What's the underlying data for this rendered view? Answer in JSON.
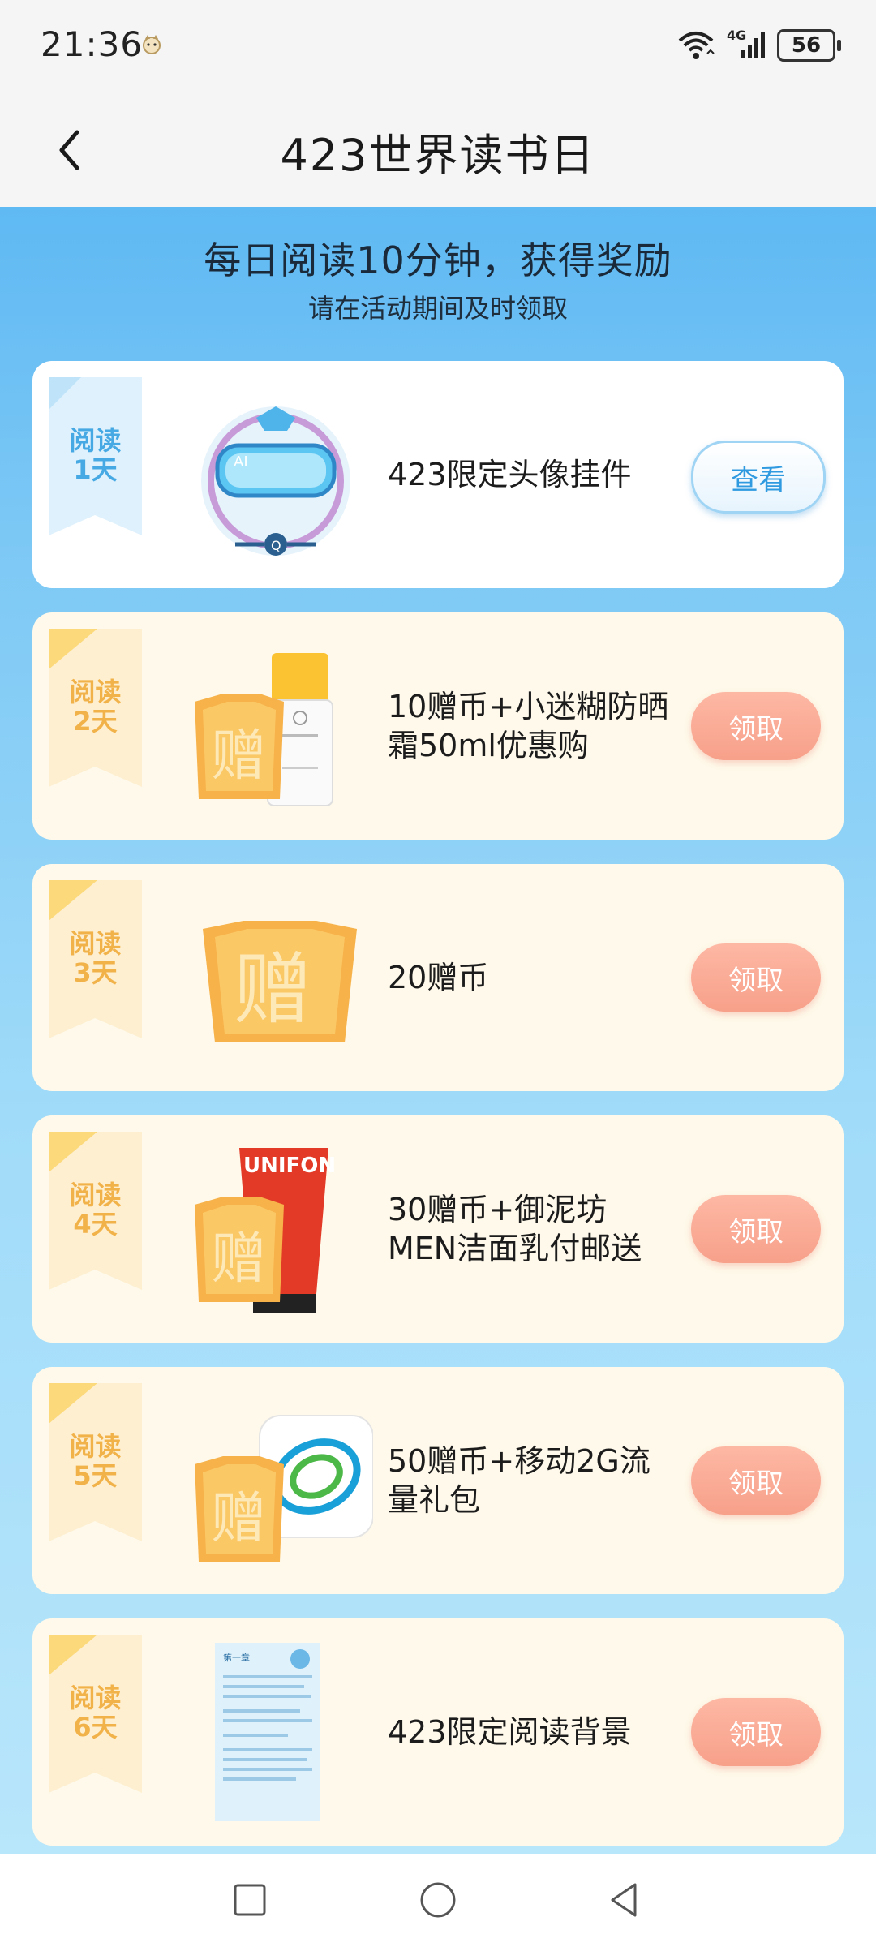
{
  "status_bar": {
    "time": "21:36",
    "network": "4G",
    "battery": "56"
  },
  "header": {
    "title": "423世界读书日",
    "back_icon": "chevron-left-icon"
  },
  "banner": {
    "headline": "每日阅读10分钟，获得奖励",
    "subhead": "请在活动期间及时领取"
  },
  "rewards": [
    {
      "ribbon": "阅读\n1天",
      "text": "423限定头像挂件",
      "button": "查看",
      "state": "done"
    },
    {
      "ribbon": "阅读\n2天",
      "text": "10赠币+小迷糊防晒霜50ml优惠购",
      "button": "领取",
      "state": "pending"
    },
    {
      "ribbon": "阅读\n3天",
      "text": "20赠币",
      "button": "领取",
      "state": "pending"
    },
    {
      "ribbon": "阅读\n4天",
      "text": "30赠币+御泥坊MEN洁面乳付邮送",
      "button": "领取",
      "state": "pending"
    },
    {
      "ribbon": "阅读\n5天",
      "text": "50赠币+移动2G流量礼包",
      "button": "领取",
      "state": "pending"
    },
    {
      "ribbon": "阅读\n6天",
      "text": "423限定阅读背景",
      "button": "领取",
      "state": "pending"
    }
  ],
  "gift_stamp": "赠",
  "product_brand": "UNIFON",
  "book_chapter": "第一章",
  "colors": {
    "accent_blue": "#46a9e3",
    "claim_button": "#f7a08a",
    "pending_card": "#fef9ea",
    "ribbon_gold": "#f2b24a"
  },
  "nav": {
    "recent": "square-icon",
    "home": "circle-icon",
    "back": "triangle-back-icon"
  }
}
